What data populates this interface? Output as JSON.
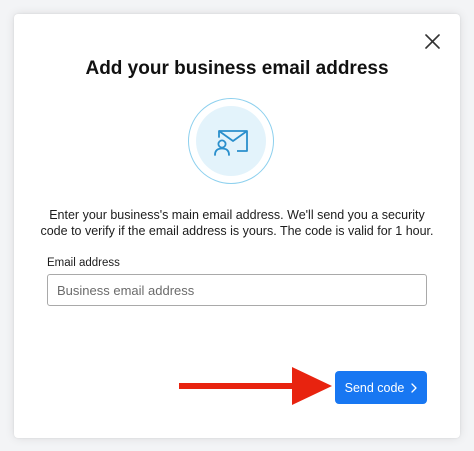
{
  "dialog": {
    "title": "Add your business email address",
    "description": "Enter your business's main email address. We'll send you a security code to verify if the email address is yours. The code is valid for 1 hour.",
    "email_label": "Email address",
    "email_placeholder": "Business email address",
    "email_value": "",
    "send_button_label": "Send code",
    "icons": {
      "close": "close-icon",
      "illustration": "email-verification-icon",
      "send_chevron": "chevron-right-icon",
      "annotation": "red-arrow-annotation"
    }
  },
  "colors": {
    "primary_button": "#1877f2",
    "illustration_ring": "#8dd0ee",
    "illustration_fill": "#e3f3fb",
    "illustration_stroke": "#2a8fcc",
    "annotation_arrow": "#e8230f"
  }
}
